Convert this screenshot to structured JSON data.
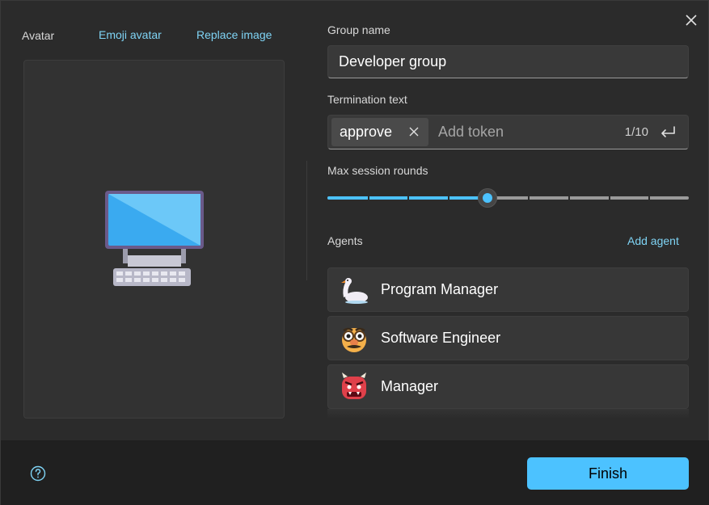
{
  "header": {
    "close_icon": "close-icon"
  },
  "avatar": {
    "label": "Avatar",
    "emoji_avatar_link": "Emoji avatar",
    "replace_image_link": "Replace image",
    "image_icon": "desktop-computer-icon"
  },
  "group_name": {
    "label": "Group name",
    "value": "Developer group"
  },
  "termination": {
    "label": "Termination text",
    "tokens": [
      "approve"
    ],
    "placeholder": "Add token",
    "count": "1/10"
  },
  "rounds": {
    "label": "Max session rounds",
    "value_fraction": 0.444,
    "steps": 9
  },
  "agents": {
    "label": "Agents",
    "add_label": "Add agent",
    "items": [
      {
        "name": "Program Manager",
        "icon": "swan-icon"
      },
      {
        "name": "Software Engineer",
        "icon": "disguised-face-icon"
      },
      {
        "name": "Manager",
        "icon": "ogre-icon"
      }
    ]
  },
  "footer": {
    "finish_label": "Finish",
    "help_icon": "help-icon"
  },
  "colors": {
    "accent": "#4cc2ff",
    "link": "#7fd4f5",
    "background": "#2b2b2b"
  }
}
